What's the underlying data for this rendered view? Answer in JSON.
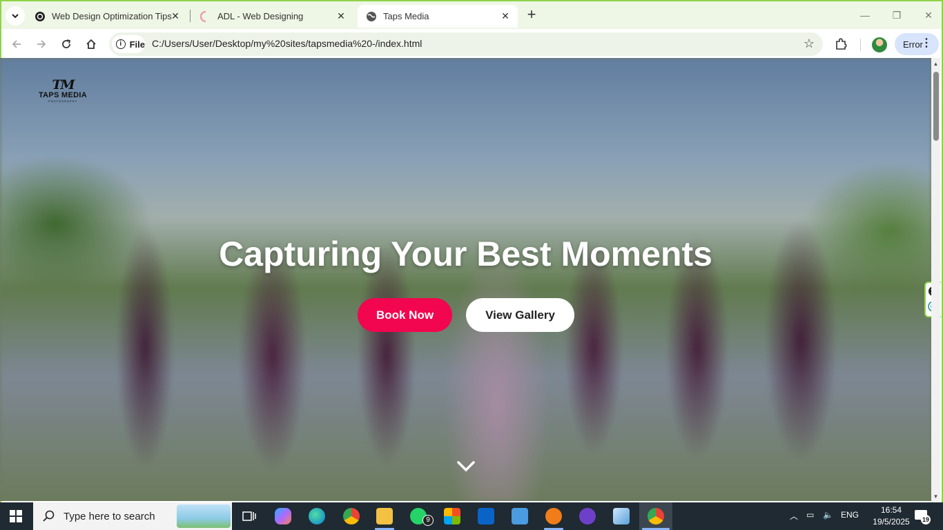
{
  "browser": {
    "tabs": [
      {
        "title": "Web Design Optimization Tips",
        "icon": "openai-icon"
      },
      {
        "title": "ADL - Web Designing",
        "icon": "loading-icon"
      },
      {
        "title": "Taps Media",
        "icon": "globe-icon"
      }
    ],
    "address": {
      "chip_label": "File",
      "url": "C:/Users/User/Desktop/my%20sites/tapsmedia%20-/index.html"
    },
    "error_button": "Error"
  },
  "page": {
    "logo": {
      "mark": "TM",
      "name": "TAPS MEDIA",
      "sub": "PHOTOGRAPHY"
    },
    "hero_title": "Capturing Your Best Moments",
    "book_button": "Book Now",
    "gallery_button": "View Gallery",
    "accent_color": "#f1064f"
  },
  "taskbar": {
    "search_placeholder": "Type here to search",
    "whatsapp_badge": "9",
    "language": "ENG",
    "time": "16:54",
    "date": "19/5/2025",
    "notification_count": "19"
  }
}
